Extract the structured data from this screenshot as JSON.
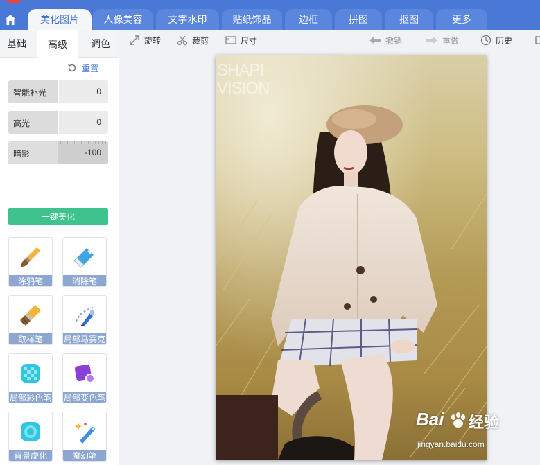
{
  "main_tabs": [
    "美化图片",
    "人像美容",
    "文字水印",
    "贴纸饰品",
    "边框",
    "拼图",
    "抠图",
    "更多"
  ],
  "sub_tabs": [
    "基础",
    "高级",
    "调色"
  ],
  "reset_label": "重置",
  "sliders": [
    {
      "label": "智能补光",
      "value": "0",
      "level": 0.5
    },
    {
      "label": "高光",
      "value": "0",
      "level": 0.5
    },
    {
      "label": "暗影",
      "value": "-100",
      "level": 0.0
    }
  ],
  "beautify_label": "一键美化",
  "tools": [
    "涂鸦笔",
    "消除笔",
    "取样笔",
    "局部马赛克",
    "局部彩色笔",
    "局部变色笔",
    "背景虚化",
    "魔幻笔"
  ],
  "toolbar": {
    "rotate": "旋转",
    "crop": "裁剪",
    "size": "尺寸",
    "undo": "撤销",
    "redo": "重做",
    "history": "历史"
  },
  "photo_watermark": {
    "line1": "SHAPI",
    "line2": "VISION"
  },
  "baidu_watermark": {
    "brand": "Bai",
    "brand_cn": "经验",
    "url": "jingyan.baidu.com"
  },
  "colors": {
    "accent": "#4a78d6",
    "green": "#3fc38e",
    "tool_caption": "#8ea7d1"
  }
}
